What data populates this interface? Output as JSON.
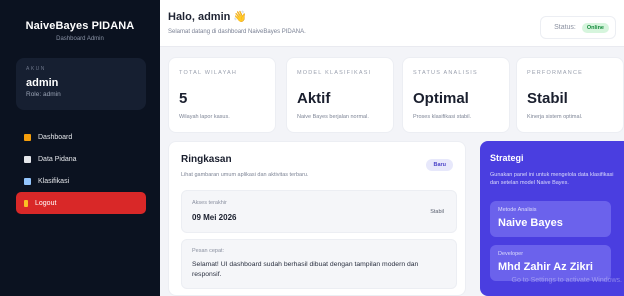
{
  "sidebar": {
    "brand_title": "NaiveBayes PIDANA",
    "brand_sub": "Dashboard Admin",
    "account_label": "AKUN",
    "account_name": "admin",
    "account_role": "Role: admin",
    "items": [
      {
        "label": "Dashboard",
        "icon": "dashboard-icon",
        "color": "#f59e0b"
      },
      {
        "label": "Data Pidana",
        "icon": "document-icon",
        "color": "#e5e7eb"
      },
      {
        "label": "Klasifikasi",
        "icon": "chart-icon",
        "color": "#93c5fd"
      },
      {
        "label": "Logout",
        "icon": "logout-icon",
        "color": "#fbbf24"
      }
    ]
  },
  "header": {
    "greeting": "Halo, admin 👋",
    "subtitle": "Selamat datang di dashboard NaiveBayes PIDANA.",
    "status_label": "Status:",
    "status_value": "Online"
  },
  "stats": [
    {
      "label": "TOTAL WILAYAH",
      "value": "5",
      "desc": "Wilayah lapor kasus."
    },
    {
      "label": "MODEL KLASIFIKASI",
      "value": "Aktif",
      "desc": "Naive Bayes berjalan normal."
    },
    {
      "label": "STATUS ANALISIS",
      "value": "Optimal",
      "desc": "Proses klasifikasi stabil."
    },
    {
      "label": "PERFORMANCE",
      "value": "Stabil",
      "desc": "Kinerja sistem optimal."
    }
  ],
  "summary": {
    "title": "Ringkasan",
    "subtitle": "Lihat gambaran umum aplikasi dan aktivitas terbaru.",
    "badge": "Baru",
    "access_label": "Akses terakhir",
    "access_date": "09 Mei 2026",
    "access_status": "Stabil",
    "message_label": "Pesan cepat:",
    "message_text": "Selamat! UI dashboard sudah berhasil dibuat dengan tampilan modern dan responsif."
  },
  "strategy": {
    "title": "Strategi",
    "desc": "Gunakan panel ini untuk mengelola data klasifikasi dan setelan model Naive Bayes.",
    "method_label": "Metode Analisis",
    "method_value": "Naive Bayes",
    "dev_label": "Developer",
    "dev_value": "Mhd Zahir Az Zikri"
  },
  "watermark": "Go to Settings to activate Windows."
}
